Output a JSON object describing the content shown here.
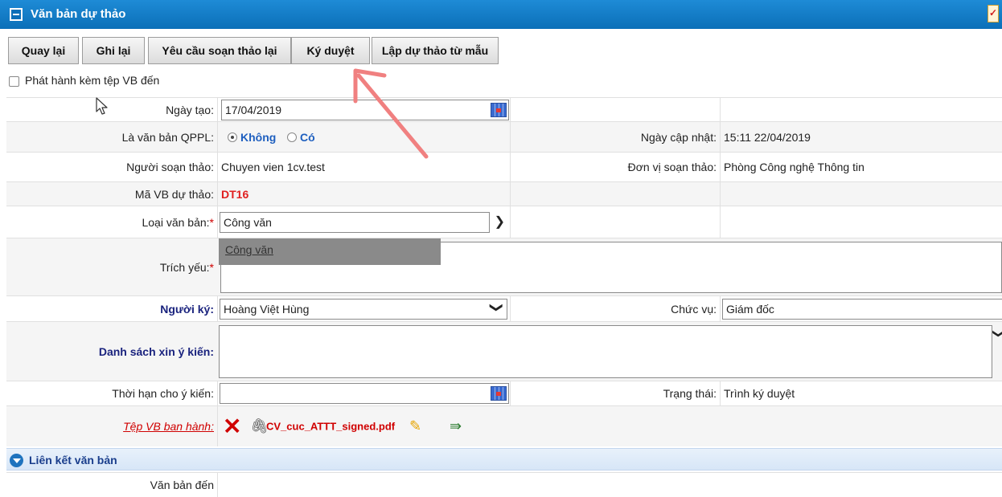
{
  "window": {
    "title": "Văn bản dự thảo"
  },
  "toolbar": {
    "back": "Quay lại",
    "save": "Ghi lại",
    "request_redraft": "Yêu cầu soạn thảo lại",
    "approve_sign": "Ký duyệt",
    "draft_from_template": "Lập dự thảo từ mẫu"
  },
  "attach_incoming": {
    "label": "Phát hành kèm tệp VB đến",
    "checked": false
  },
  "form": {
    "created_date_label": "Ngày tạo:",
    "created_date": "17/04/2019",
    "legal_doc_label": "Là văn bản QPPL:",
    "legal_doc_no": "Không",
    "legal_doc_yes": "Có",
    "updated_label": "Ngày cập nhật:",
    "updated_value": "15:11 22/04/2019",
    "drafter_label": "Người soạn thảo:",
    "drafter_value": "Chuyen vien 1cv.test",
    "unit_label": "Đơn vị soạn thảo:",
    "unit_value": "Phòng Công nghệ Thông tin",
    "code_label": "Mã VB dự thảo:",
    "code_value": "DT16",
    "doc_type_label": "Loại văn bản:",
    "doc_type_value": "Công văn",
    "doc_type_option": "Công văn",
    "summary_label": "Trích yếu:",
    "signer_label": "Người ký:",
    "signer_value": "Hoàng Việt Hùng",
    "position_label": "Chức vụ:",
    "position_value": "Giám đốc",
    "opinion_list_label": "Danh sách xin ý kiến:",
    "deadline_label": "Thời hạn cho ý kiến:",
    "status_label": "Trạng thái:",
    "status_value": "Trình ký duyệt",
    "issue_file_label": "Tệp VB ban hành:",
    "issue_file_name": "CV_cuc_ATTT_signed.pdf",
    "required_mark": "*"
  },
  "links_section": {
    "title": "Liên kết văn bản",
    "incoming_label": "Văn bản đến"
  },
  "colors": {
    "header": "#0b6fb8",
    "required": "#d00000",
    "code": "#e02020",
    "arrow": "#f08080"
  }
}
